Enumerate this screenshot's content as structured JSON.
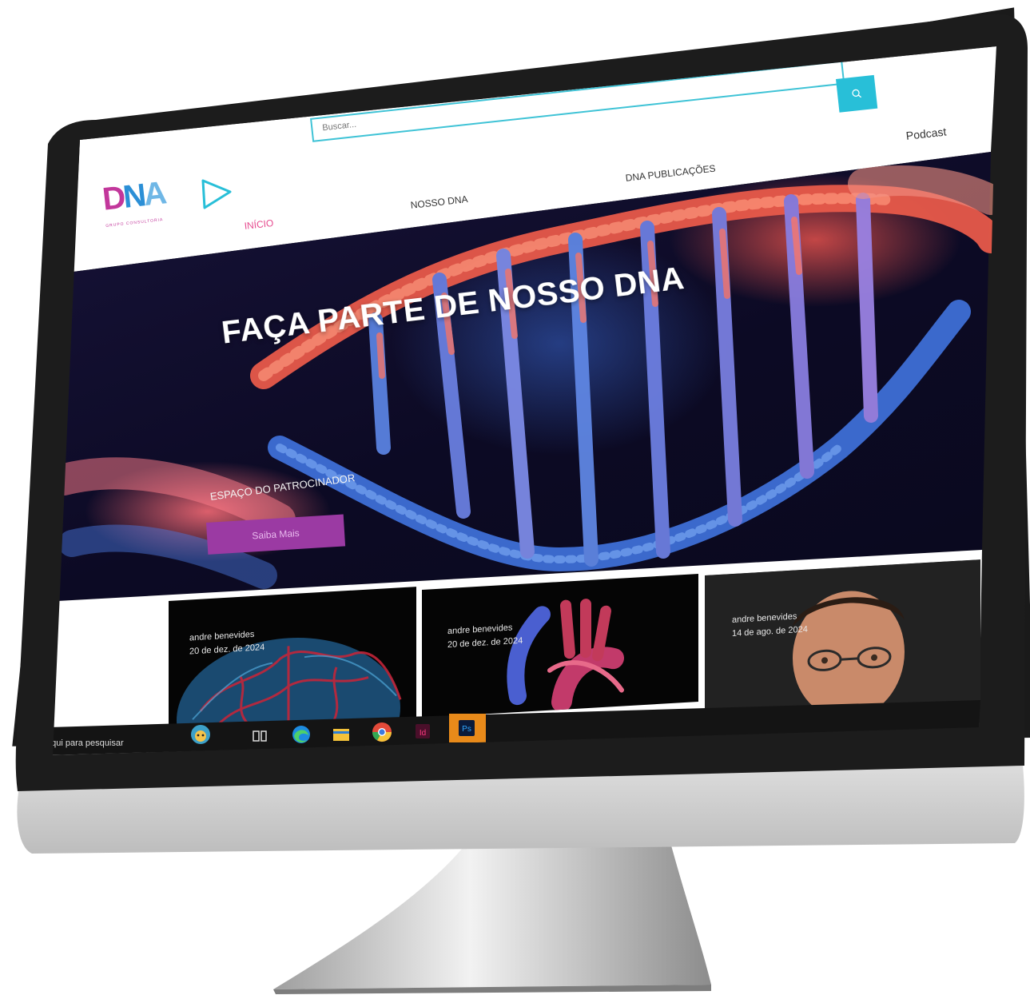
{
  "header": {
    "logo_text": "DNA",
    "logo_subtitle": "GRUPO CONSULTORIA",
    "nav": [
      {
        "label": "INÍCIO",
        "active": true
      },
      {
        "label": "NOSSO DNA",
        "active": false
      },
      {
        "label": "DNA PUBLICAÇÕES",
        "active": false
      },
      {
        "label": "Podcast",
        "active": false
      }
    ],
    "search_placeholder": "Buscar..."
  },
  "hero": {
    "title": "FAÇA PARTE DE NOSSO DNA",
    "sponsor_label": "ESPAÇO DO PATROCINADOR",
    "button_label": "Saiba Mais"
  },
  "posts": [
    {
      "author": "andre benevides",
      "date": "20 de dez. de 2024",
      "icon": "brain-image"
    },
    {
      "author": "andre benevides",
      "date": "20 de dez. de 2024",
      "icon": "heart-image"
    },
    {
      "author": "andre benevides",
      "date": "14 de ago. de 2024",
      "icon": "portrait-image"
    }
  ],
  "taskbar": {
    "search_text": "aqui para pesquisar",
    "apps": [
      "widget-icon",
      "task-view-icon",
      "edge-icon",
      "file-explorer-icon",
      "chrome-icon",
      "indesign-icon",
      "photoshop-icon"
    ]
  },
  "colors": {
    "accent_cyan": "#28bfd8",
    "logo_magenta": "#c2379b",
    "active_nav_pink": "#e64a8e",
    "button_purple": "#9b3aa3"
  }
}
